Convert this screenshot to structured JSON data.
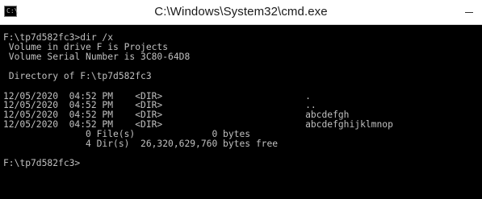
{
  "window": {
    "title": "C:\\Windows\\System32\\cmd.exe",
    "icon": "cmd-icon",
    "icon_glyph": "C:\\"
  },
  "console": {
    "text_color": "#c0c0c0",
    "background": "#000000",
    "lines": [
      "F:\\tp7d582fc3>dir /x",
      " Volume in drive F is Projects",
      " Volume Serial Number is 3C80-64D8",
      "",
      " Directory of F:\\tp7d582fc3",
      "",
      "12/05/2020  04:52 PM    <DIR>                          .",
      "12/05/2020  04:52 PM    <DIR>                          ..",
      "12/05/2020  04:52 PM    <DIR>                          abcdefgh",
      "12/05/2020  04:52 PM    <DIR>                          abcdefghijklmnop",
      "               0 File(s)              0 bytes",
      "               4 Dir(s)  26,320,629,760 bytes free",
      "",
      "F:\\tp7d582fc3>"
    ]
  }
}
